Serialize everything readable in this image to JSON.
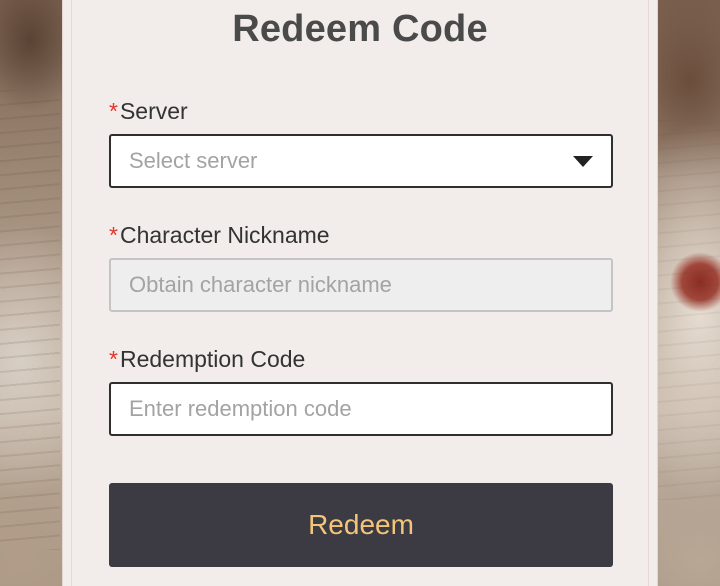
{
  "form": {
    "title": "Redeem Code",
    "required_mark": "*",
    "server": {
      "label": "Server",
      "placeholder": "Select server",
      "icon": "caret-down-icon"
    },
    "nickname": {
      "label": "Character Nickname",
      "placeholder": "Obtain character nickname"
    },
    "code": {
      "label": "Redemption Code",
      "placeholder": "Enter redemption code"
    },
    "submit_label": "Redeem"
  },
  "colors": {
    "required": "#e5362d",
    "button_bg": "#3c3a43",
    "button_text": "#f2c578",
    "card_bg": "#f2ecea"
  }
}
